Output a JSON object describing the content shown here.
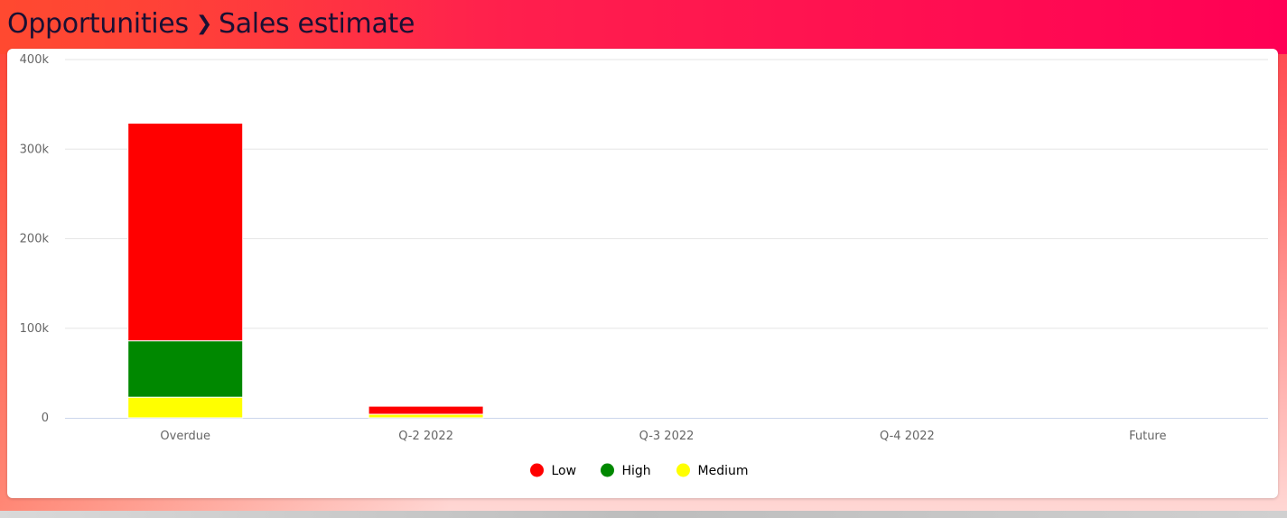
{
  "breadcrumb": {
    "parent": "Opportunities",
    "separator": "❯",
    "current": "Sales estimate"
  },
  "chart_data": {
    "type": "bar",
    "stacked": true,
    "categories": [
      "Overdue",
      "Q-2 2022",
      "Q-3 2022",
      "Q-4 2022",
      "Future"
    ],
    "series": [
      {
        "name": "Low",
        "color": "#ff0000",
        "values": [
          243000,
          9000,
          0,
          0,
          0
        ]
      },
      {
        "name": "High",
        "color": "#008800",
        "values": [
          63000,
          0,
          0,
          0,
          0
        ]
      },
      {
        "name": "Medium",
        "color": "#ffff00",
        "values": [
          23000,
          4000,
          0,
          0,
          0
        ]
      }
    ],
    "stack_order_bottom_to_top": [
      "Medium",
      "High",
      "Low"
    ],
    "ylim": [
      0,
      400000
    ],
    "yticks": [
      0,
      100000,
      200000,
      300000,
      400000
    ],
    "ytick_labels": [
      "0",
      "100k",
      "200k",
      "300k",
      "400k"
    ],
    "grid": true,
    "legend": {
      "placement": "bottom-center",
      "entries": [
        "Low",
        "High",
        "Medium"
      ]
    },
    "colors": {
      "grid": "#e6e6e6",
      "axis": "#ccd6eb",
      "tick_text": "#666666",
      "legend_text": "#000000"
    }
  }
}
